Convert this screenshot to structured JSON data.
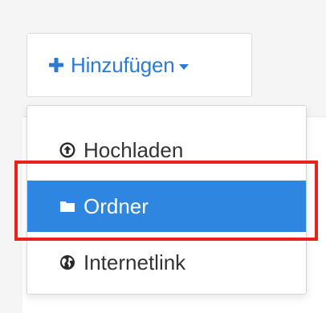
{
  "toolbar": {
    "add_label": "Hinzufügen",
    "add_icon": "plus-icon",
    "caret_icon": "caret-down-icon"
  },
  "menu": {
    "items": [
      {
        "label": "Hochladen",
        "icon": "upload-circle-icon",
        "active": false
      },
      {
        "label": "Ordner",
        "icon": "folder-icon",
        "active": true
      },
      {
        "label": "Internetlink",
        "icon": "globe-icon",
        "active": false
      }
    ]
  },
  "colors": {
    "accent": "#2b7ad3",
    "active_item_bg": "#2f86e0",
    "highlight_border": "#e8201e",
    "text": "#333333"
  }
}
